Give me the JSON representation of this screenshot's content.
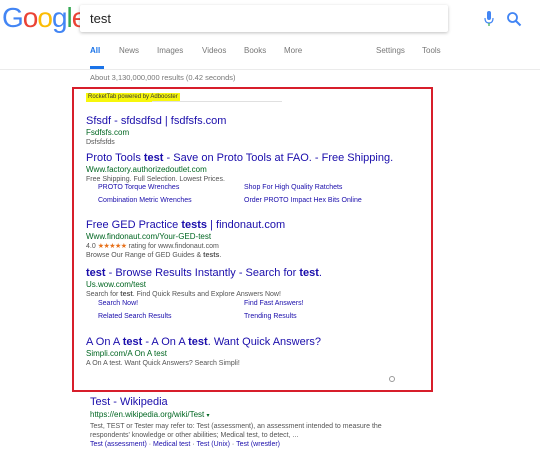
{
  "header": {
    "logo_letters": [
      "G",
      "o",
      "o",
      "g",
      "l",
      "e"
    ],
    "search_value": "test",
    "tabs": [
      {
        "label": "All"
      },
      {
        "label": "News"
      },
      {
        "label": "Images"
      },
      {
        "label": "Videos"
      },
      {
        "label": "Books"
      },
      {
        "label": "More"
      },
      {
        "label": "Settings"
      },
      {
        "label": "Tools"
      }
    ],
    "active_tab": "All",
    "colors": {
      "accent": "#1a73e8",
      "g_blue": "#4285f4",
      "g_red": "#ea4335",
      "g_yellow": "#fbbc05",
      "g_green": "#34a853"
    }
  },
  "results_stats": "About 3,130,000,000 results (0.42 seconds)",
  "ad_frame": {
    "tag": "RocketTab powered by Adbooster",
    "border_color": "#d71e2b",
    "tag_bg": "#f7f70c",
    "ads": [
      {
        "title": "Sfsdf - sfdsdfsd | fsdfsfs.com",
        "url": "Fsdfsfs.com",
        "desc": "Dsfsfsfds"
      },
      {
        "title_pre": "Proto Tools ",
        "title_bold": "test",
        "title_post": " - Save on Proto Tools at FAO. - Free Shipping.",
        "url": "Www.factory.authorizedoutlet.com",
        "desc": "Free Shipping. Full Selection. Lowest Prices.",
        "sitelinks": [
          "PROTO Torque Wrenches",
          "Shop For High Quality Ratchets",
          "Combination Metric Wrenches",
          "Order PROTO Impact Hex Bits Online"
        ]
      },
      {
        "title_pre": "Free GED Practice ",
        "title_bold": "tests",
        "title_post": " | findonaut.com",
        "url": "Www.findonaut.com/Your-GED-test",
        "rating_value": "4.0",
        "stars": "★★★★★",
        "rating_text": "rating for www.findonaut.com",
        "desc_pre": "Browse Our Range of GED Guides & ",
        "desc_bold": "tests",
        "desc_post": "."
      },
      {
        "title_bold1": "test",
        "title_mid": " - Browse Results Instantly - Search for ",
        "title_bold2": "test",
        "title_post": ".",
        "url": "Us.wow.com/test",
        "desc_pre": "Search for ",
        "desc_bold": "test",
        "desc_post": ". Find Quick Results and Explore Answers Now!",
        "sitelinks": [
          "Search Now!",
          "Find Fast Answers!",
          "Related Search Results",
          "Trending Results"
        ]
      },
      {
        "title_pre": "A On A ",
        "title_bold1": "test",
        "title_mid": " - A On A ",
        "title_bold2": "test",
        "title_post": ". Want Quick Answers?",
        "url": "Simpli.com/A On A test",
        "desc": "A On A test. Want Quick Answers? Search Simpli!"
      }
    ]
  },
  "organic": {
    "title": "Test - Wikipedia",
    "url": "https://en.wikipedia.org/wiki/Test",
    "caret": "▾",
    "snippet1": "Test, TEST or Tester may refer to: Test (assessment), an assessment intended to measure the",
    "snippet2": "respondents' knowledge or other abilities; Medical test, to detect, ...",
    "links": [
      "Test (assessment)",
      "Medical test",
      "Test (Unix)",
      "Test (wrestler)"
    ],
    "link_sep": " · "
  }
}
